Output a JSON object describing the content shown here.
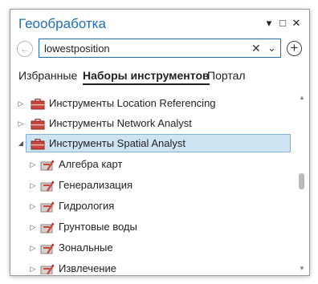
{
  "pane": {
    "title": "Геообработка",
    "controls": {
      "options": "▾",
      "maximize": "□",
      "close": "✕"
    }
  },
  "search": {
    "back_icon": "←",
    "value": "lowestposition",
    "clear_icon": "✕",
    "dropdown_icon": "⌄",
    "add_icon": "+"
  },
  "tabs": [
    {
      "label": "Избранные",
      "active": false
    },
    {
      "label": "Наборы инструментов",
      "active": true
    },
    {
      "label": "Портал",
      "active": false
    }
  ],
  "tree": {
    "items": [
      {
        "label": "Инструменты Location Referencing",
        "expander": "▷",
        "level": 0,
        "selected": false,
        "icon": "toolbox-icon"
      },
      {
        "label": "Инструменты Network Analyst",
        "expander": "▷",
        "level": 0,
        "selected": false,
        "icon": "toolbox-icon"
      },
      {
        "label": "Инструменты Spatial Analyst",
        "expander": "◢",
        "level": 0,
        "selected": true,
        "icon": "toolbox-icon"
      },
      {
        "label": "Алгебра карт",
        "expander": "▷",
        "level": 1,
        "selected": false,
        "icon": "toolset-icon"
      },
      {
        "label": "Генерализация",
        "expander": "▷",
        "level": 1,
        "selected": false,
        "icon": "toolset-icon"
      },
      {
        "label": "Гидрология",
        "expander": "▷",
        "level": 1,
        "selected": false,
        "icon": "toolset-icon"
      },
      {
        "label": "Грунтовые воды",
        "expander": "▷",
        "level": 1,
        "selected": false,
        "icon": "toolset-icon"
      },
      {
        "label": "Зональные",
        "expander": "▷",
        "level": 1,
        "selected": false,
        "icon": "toolset-icon"
      },
      {
        "label": "Извлечение",
        "expander": "▷",
        "level": 1,
        "selected": false,
        "icon": "toolset-icon"
      }
    ]
  },
  "scrollbar": {
    "up_icon": "▲",
    "down_icon": "▼"
  },
  "colors": {
    "title": "#1f6fb2",
    "toolbox": "#c9463d",
    "selection_bg": "#cfe4f3",
    "selection_border": "#7fb3da"
  }
}
